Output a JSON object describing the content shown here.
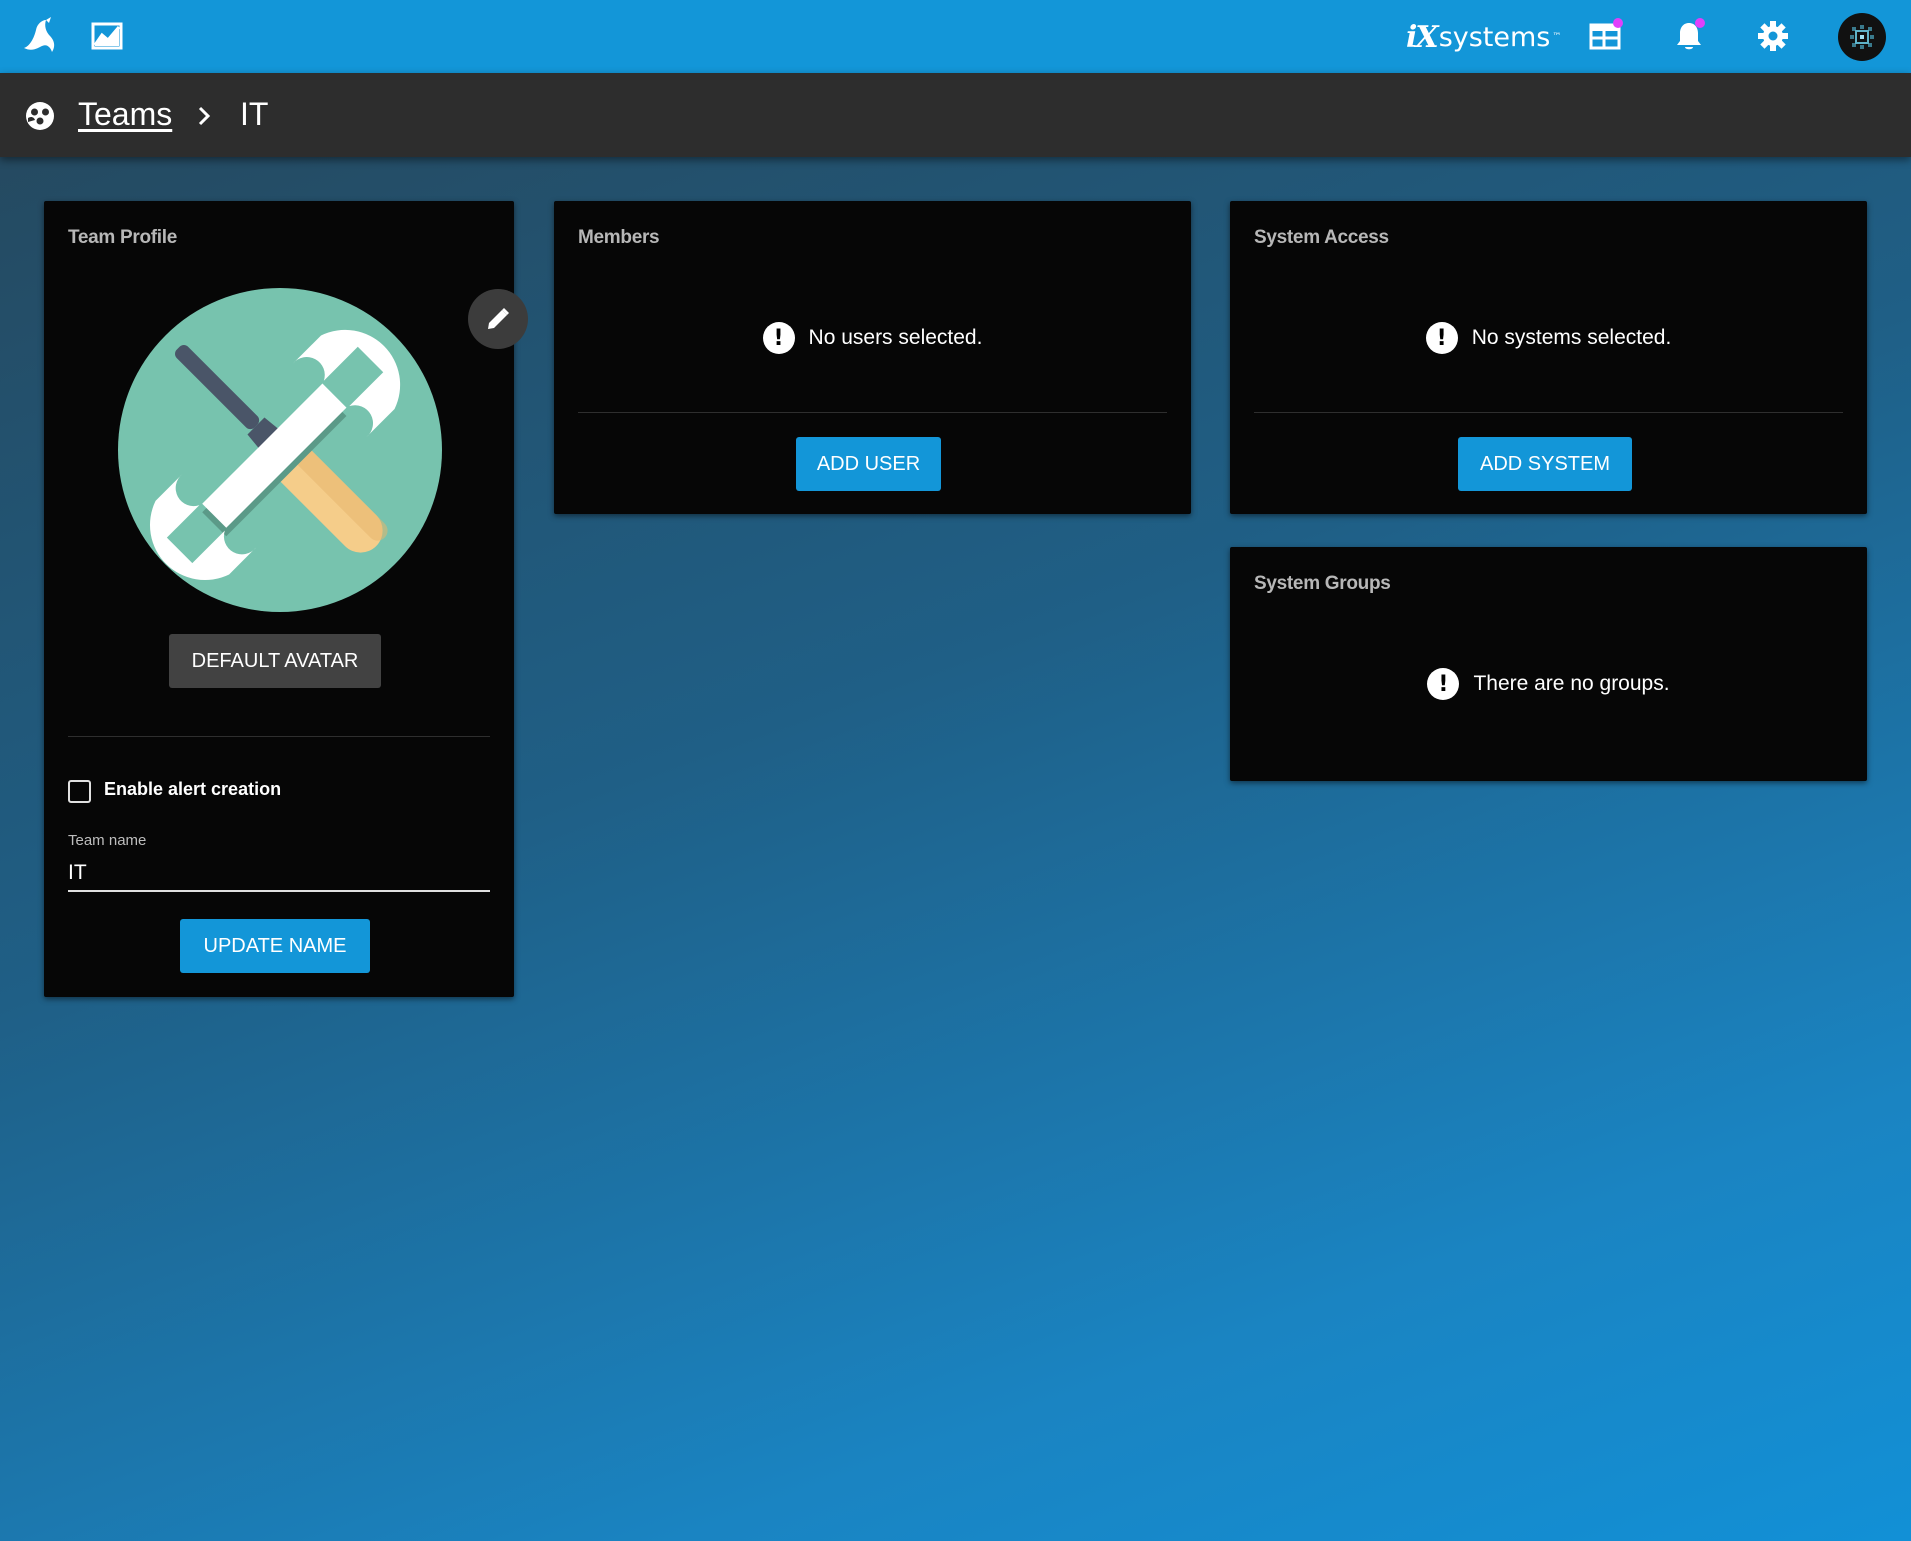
{
  "topbar": {
    "brand_ix": "iX",
    "brand_systems": "systems",
    "brand_tm": "™",
    "icons": [
      "app-logo-icon",
      "dashboard-chart-icon",
      "calendar-grid-icon",
      "notification-bell-icon",
      "settings-gear-icon",
      "user-avatar-icon"
    ],
    "badge_color": "#e040fb",
    "accent": "#1396d8"
  },
  "breadcrumb": {
    "icon": "teams-icon",
    "parent": "Teams",
    "current": "IT"
  },
  "team_profile": {
    "title": "Team Profile",
    "default_avatar_label": "DEFAULT AVATAR",
    "alert_label": "Enable alert creation",
    "alert_checked": false,
    "team_name_label": "Team name",
    "team_name_value": "IT",
    "update_label": "UPDATE NAME"
  },
  "members": {
    "title": "Members",
    "empty_text": "No users selected.",
    "add_label": "ADD USER"
  },
  "system_access": {
    "title": "System Access",
    "empty_text": "No systems selected.",
    "add_label": "ADD SYSTEM"
  },
  "system_groups": {
    "title": "System Groups",
    "empty_text": "There are no groups."
  }
}
